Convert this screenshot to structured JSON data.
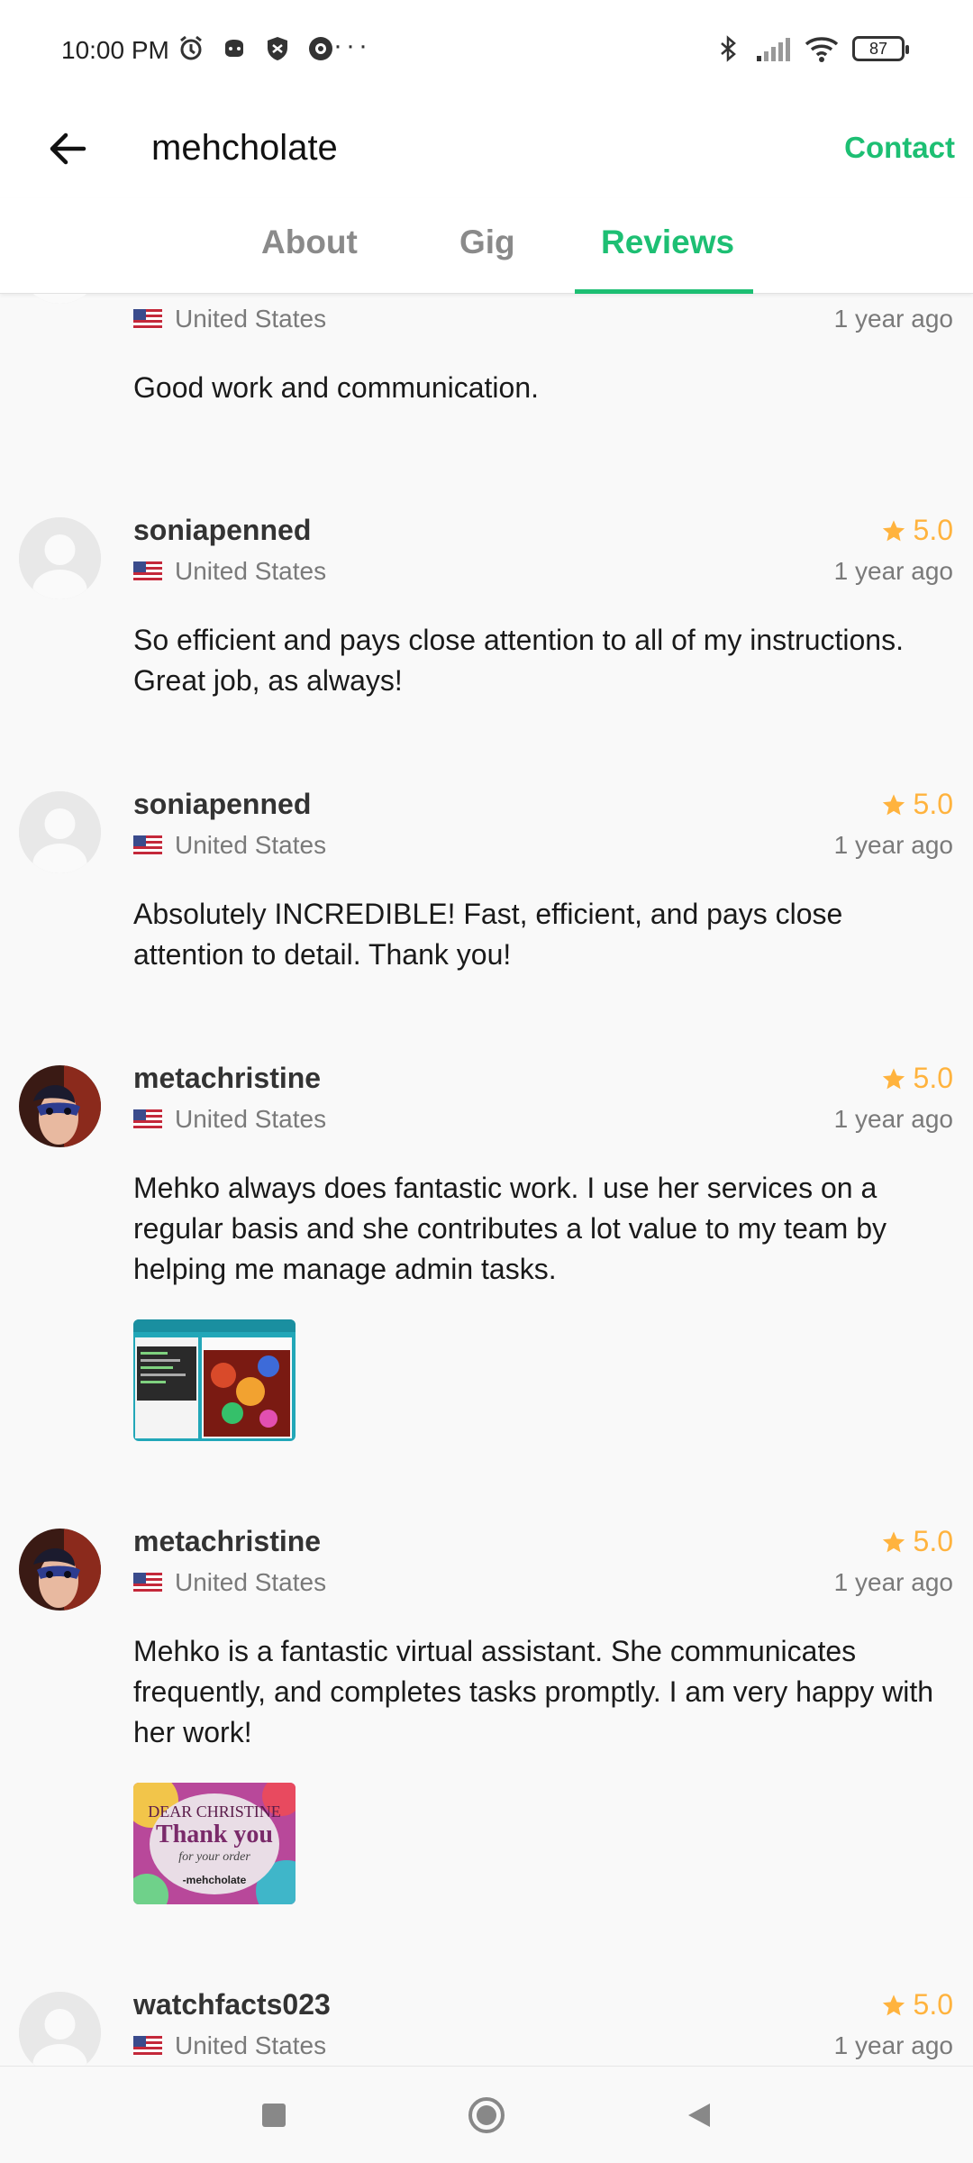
{
  "status_bar": {
    "time": "10:00 PM",
    "dots": "···",
    "battery": "87"
  },
  "header": {
    "title": "mehcholate",
    "contact": "Contact"
  },
  "tabs": [
    {
      "label": "About"
    },
    {
      "label": "Gig"
    },
    {
      "label": "Reviews"
    }
  ],
  "reviews": [
    {
      "username": "",
      "country": "United States",
      "time": "1 year ago",
      "comment": "Good work and communication."
    },
    {
      "username": "soniapenned",
      "rating": "5.0",
      "country": "United States",
      "time": "1 year ago",
      "comment": "So efficient and pays close attention to all of my instructions. Great job, as always!"
    },
    {
      "username": "soniapenned",
      "rating": "5.0",
      "country": "United States",
      "time": "1 year ago",
      "comment": "Absolutely INCREDIBLE! Fast, efficient, and pays close attention to detail. Thank you!"
    },
    {
      "username": "metachristine",
      "rating": "5.0",
      "country": "United States",
      "time": "1 year ago",
      "comment": "Mehko always does fantastic work. I use her services on a regular basis and she contributes a lot value to my team by helping me manage admin tasks."
    },
    {
      "username": "metachristine",
      "rating": "5.0",
      "country": "United States",
      "time": "1 year ago",
      "comment": "Mehko is a fantastic virtual assistant. She communicates frequently, and completes tasks promptly. I am very happy with her work!",
      "attachment_line1": "DEAR CHRISTINE",
      "attachment_line2": "Thank you",
      "attachment_line3": "for your order",
      "attachment_line4": "-mehcholate"
    },
    {
      "username": "watchfacts023",
      "rating": "5.0",
      "country": "United States",
      "time": "1 year ago"
    }
  ],
  "colors": {
    "accent": "#1dbf73",
    "star": "#ffb33e",
    "muted_text": "#7a7a7a"
  }
}
